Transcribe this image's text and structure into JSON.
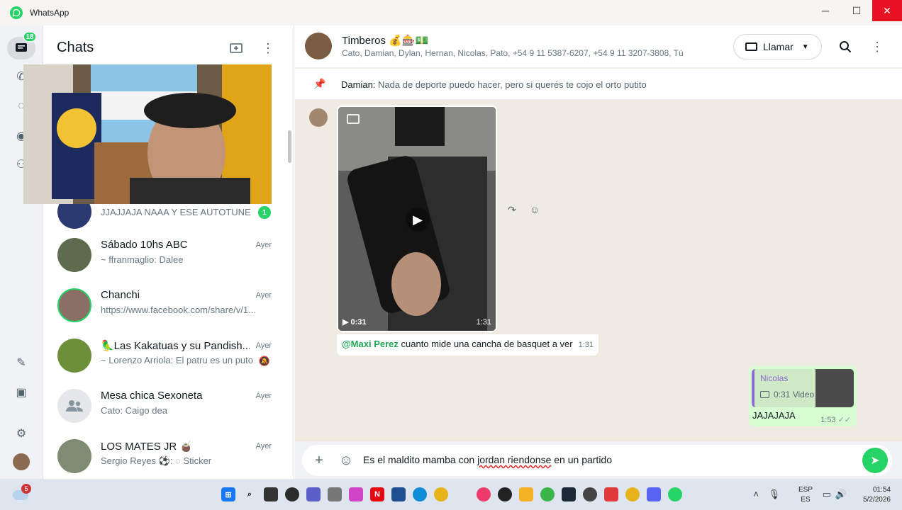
{
  "window": {
    "title": "WhatsApp",
    "minimize": "─",
    "maximize": "☐",
    "close": "✕"
  },
  "rail": {
    "unread_badge": "18"
  },
  "chatlist": {
    "title": "Chats",
    "items": [
      {
        "name": "",
        "preview": "JJAJJAJA NAAA Y ESE AUTOTUNE",
        "time": "",
        "unread": "1",
        "avatar_color": "#2a3a70"
      },
      {
        "name": "Sábado 10hs ABC",
        "preview": "~ ffranmaglio: Dalee",
        "time": "Ayer",
        "unread": "",
        "avatar_color": "#5d6b4f"
      },
      {
        "name": "Chanchi",
        "preview": "https://www.facebook.com/share/v/1...",
        "time": "Ayer",
        "unread": "",
        "avatar_color": "#8a6f66"
      },
      {
        "name": "🦜Las Kakatuas y su Pandish...",
        "preview": "~ Lorenzo Arriola: El patru es un puto",
        "time": "Ayer",
        "unread": "",
        "avatar_color": "#6c8f3a"
      },
      {
        "name": "Mesa chica Sexoneta",
        "preview": "Cato: Caigo dea",
        "time": "Ayer",
        "unread": "",
        "avatar_color": "#e5e7e8"
      },
      {
        "name": "LOS MATES JR 🧉",
        "preview": "Sergio Reyes ⚽: ◌ Sticker",
        "time": "Ayer",
        "unread": "",
        "avatar_color": "#7f8b73"
      }
    ]
  },
  "conversation": {
    "group_name": "Timberos 💰🎰💵",
    "members": "Cato, Damian, Dylan, Hernan, Nicolas, Pato, +54 9 11 5387-6207, +54 9 11 3207-3808, Tú",
    "call_label": "Llamar",
    "pinned_author": "Damian:",
    "pinned_text": "Nada de deporte puedo hacer, pero si querés te cojo el orto putito",
    "video": {
      "duration": "0:31",
      "time": "1:31"
    },
    "caption": {
      "mention": "@Maxi Perez",
      "text": " cuanto mide una cancha de basquet a ver",
      "time": "1:31"
    },
    "outgoing": {
      "reply_name": "Nicolas",
      "reply_meta": "0:31 Video",
      "text": "JAJAJAJA",
      "time": "1:53",
      "ticks": "✓✓"
    },
    "composer": {
      "text_before": "Es el maldito mamba con ",
      "text_spell": "jordan riendonse",
      "text_after": " en un partido"
    }
  },
  "taskbar": {
    "weather_badge": "5",
    "lang_top": "ESP",
    "lang_bottom": "ES",
    "time": "01:54",
    "date": "5/2/2026"
  }
}
